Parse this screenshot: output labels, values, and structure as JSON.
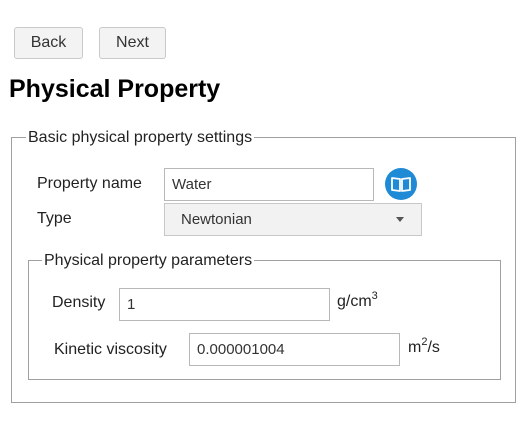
{
  "nav": {
    "back_label": "Back",
    "next_label": "Next"
  },
  "page_title": "Physical Property",
  "basic_settings": {
    "legend": "Basic physical property settings",
    "property_name_label": "Property name",
    "property_name_value": "Water",
    "type_label": "Type",
    "type_value": "Newtonian",
    "book_icon": "open-book-icon"
  },
  "parameters": {
    "legend": "Physical property parameters",
    "density_label": "Density",
    "density_value": "1",
    "density_unit_base": "g/cm",
    "density_unit_exp": "3",
    "viscosity_label": "Kinetic viscosity",
    "viscosity_value": "0.000001004",
    "viscosity_unit_base": "m",
    "viscosity_unit_exp": "2",
    "viscosity_unit_tail": "/s"
  },
  "colors": {
    "accent": "#1f8ad6",
    "border": "#a0a0a0"
  }
}
